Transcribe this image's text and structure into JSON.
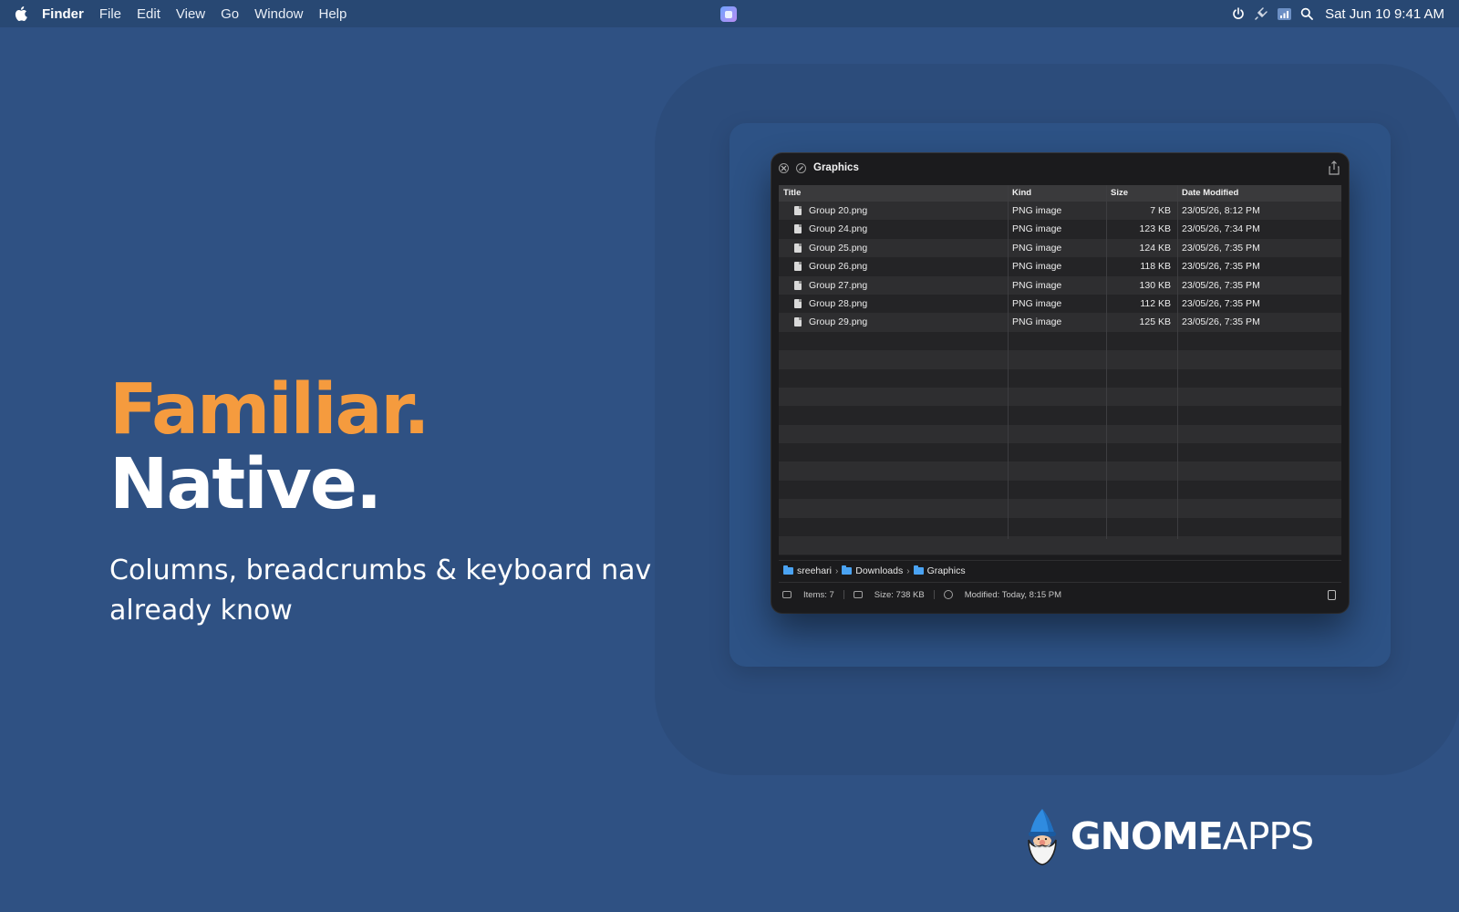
{
  "menubar": {
    "items": [
      "Finder",
      "File",
      "Edit",
      "View",
      "Go",
      "Window",
      "Help"
    ],
    "clock": "Sat Jun 10  9:41 AM",
    "status_icons": [
      "power-icon",
      "plug-icon",
      "wifi-icon",
      "search-icon"
    ]
  },
  "hero": {
    "line1": "Familiar.",
    "line2": "Native.",
    "subtitle": "Columns, breadcrumbs & keyboard nav you already know"
  },
  "window": {
    "title": "Graphics",
    "columns": [
      "Title",
      "Kind",
      "Size",
      "Date Modified"
    ],
    "rows": [
      {
        "title": "Group 20.png",
        "kind": "PNG image",
        "size": "7 KB",
        "date": "23/05/26, 8:12 PM"
      },
      {
        "title": "Group 24.png",
        "kind": "PNG image",
        "size": "123 KB",
        "date": "23/05/26, 7:34 PM"
      },
      {
        "title": "Group 25.png",
        "kind": "PNG image",
        "size": "124 KB",
        "date": "23/05/26, 7:35 PM"
      },
      {
        "title": "Group 26.png",
        "kind": "PNG image",
        "size": "118 KB",
        "date": "23/05/26, 7:35 PM"
      },
      {
        "title": "Group 27.png",
        "kind": "PNG image",
        "size": "130 KB",
        "date": "23/05/26, 7:35 PM"
      },
      {
        "title": "Group 28.png",
        "kind": "PNG image",
        "size": "112 KB",
        "date": "23/05/26, 7:35 PM"
      },
      {
        "title": "Group 29.png",
        "kind": "PNG image",
        "size": "125 KB",
        "date": "23/05/26, 7:35 PM"
      }
    ],
    "breadcrumbs": [
      "sreehari",
      "Downloads",
      "Graphics"
    ],
    "status": {
      "items": "Items: 7",
      "size": "Size: 738 KB",
      "modified": "Modified: Today, 8:15 PM"
    }
  },
  "brand": {
    "bold": "GNOME",
    "light": "APPS"
  },
  "colors": {
    "background": "#2f5183",
    "accent_orange": "#f59b3e",
    "window_bg": "#1b1b1d",
    "folder_blue": "#4aa3f3"
  }
}
